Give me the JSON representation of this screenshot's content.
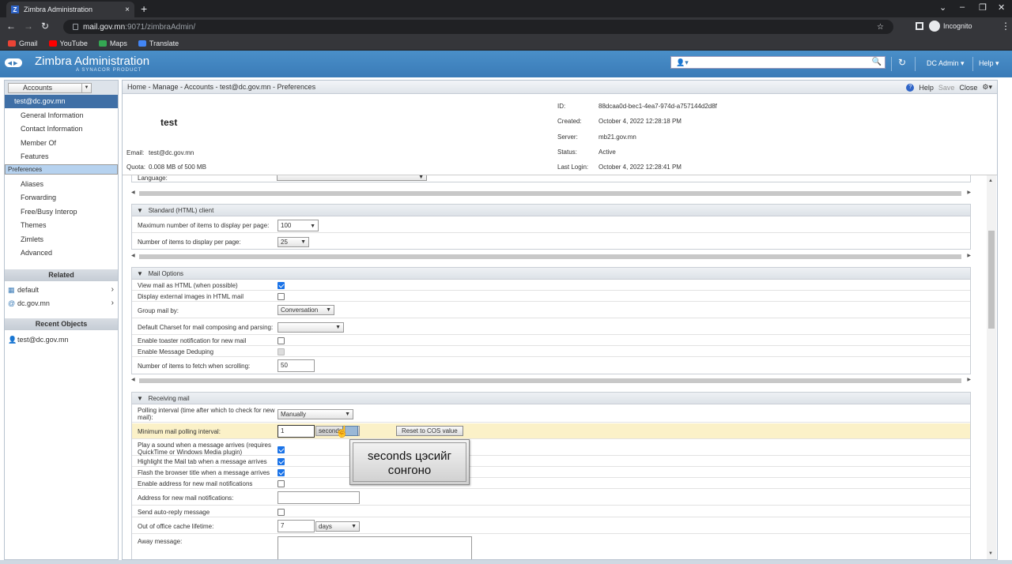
{
  "browser": {
    "tab_title": "Zimbra Administration",
    "tab_favicon": "Z",
    "url_host": "mail.gov.mn",
    "url_rest": ":9071/zimbraAdmin/",
    "incognito_label": "Incognito",
    "bookmarks": [
      {
        "label": "Gmail",
        "color": "#ea4335"
      },
      {
        "label": "YouTube",
        "color": "#ff0000"
      },
      {
        "label": "Maps",
        "color": "#34a853"
      },
      {
        "label": "Translate",
        "color": "#4285f4"
      }
    ]
  },
  "app": {
    "title": "Zimbra Administration",
    "subtitle": "A SYNACOR PRODUCT",
    "user": "DC Admin",
    "help": "Help"
  },
  "nav": {
    "selector": "Accounts",
    "header": "test@dc.gov.mn",
    "items": [
      {
        "label": "General Information"
      },
      {
        "label": "Contact Information"
      },
      {
        "label": "Member Of"
      },
      {
        "label": "Features"
      },
      {
        "label": "Preferences"
      },
      {
        "label": "Aliases"
      },
      {
        "label": "Forwarding"
      },
      {
        "label": "Free/Busy Interop"
      },
      {
        "label": "Themes"
      },
      {
        "label": "Zimlets"
      },
      {
        "label": "Advanced"
      }
    ],
    "related_title": "Related",
    "related": [
      {
        "label": "default"
      },
      {
        "label": "dc.gov.mn"
      }
    ],
    "recent_title": "Recent Objects",
    "recent": [
      {
        "label": "test@dc.gov.mn"
      }
    ]
  },
  "toolbar": {
    "breadcrumb": "Home - Manage - Accounts - test@dc.gov.mn - Preferences",
    "help": "Help",
    "save": "Save",
    "close": "Close"
  },
  "account": {
    "name": "test",
    "email_label": "Email:",
    "email": "test@dc.gov.mn",
    "quota_label": "Quota:",
    "quota": "0.008 MB of 500 MB",
    "id_label": "ID:",
    "id": "88dcaa0d-bec1-4ea7-974d-a757144d2d8f",
    "created_label": "Created:",
    "created": "October 4, 2022 12:28:18 PM",
    "server_label": "Server:",
    "server": "mb21.gov.mn",
    "status_label": "Status:",
    "status": "Active",
    "lastlogin_label": "Last Login:",
    "lastlogin": "October 4, 2022 12:28:41 PM"
  },
  "prefs": {
    "language_label": "Language:",
    "html_client": {
      "title": "Standard (HTML) client",
      "max_items_label": "Maximum number of items to display per page:",
      "max_items": "100",
      "items_label": "Number of items to display per page:",
      "items": "25"
    },
    "mail_options": {
      "title": "Mail Options",
      "view_html": "View mail as HTML (when possible)",
      "display_images": "Display external images in HTML mail",
      "group_by_label": "Group mail by:",
      "group_by": "Conversation",
      "charset_label": "Default Charset for mail composing and parsing:",
      "toaster": "Enable toaster notification for new mail",
      "dedupe": "Enable Message Deduping",
      "fetch_label": "Number of items to fetch when scrolling:",
      "fetch": "50"
    },
    "receiving": {
      "title": "Receiving mail",
      "polling_label": "Polling interval (time after which to check for new mail):",
      "polling": "Manually",
      "min_polling_label": "Minimum mail polling interval:",
      "min_polling": "1",
      "min_polling_unit": "seconds",
      "reset_button": "Reset to COS value",
      "sound_label": "Play a sound when a message arrives (requires QuickTime or Windows Media plugin)",
      "highlight_label": "Highlight the Mail tab when a message arrives",
      "flash_label": "Flash the browser title when a message arrives",
      "addr_notif_label": "Enable address for new mail notifications",
      "addr_for_label": "Address for new mail notifications:",
      "autoreply_label": "Send auto-reply message",
      "ooo_label": "Out of office cache lifetime:",
      "ooo": "7",
      "ooo_unit": "days",
      "away_label": "Away message:"
    }
  },
  "tooltip": {
    "line1": "seconds цэсийг",
    "line2": "сонгоно"
  },
  "colors": {
    "header": "#3a7bb7",
    "nav_selected": "#b6d2ef",
    "highlight_row": "#fbf1c8",
    "checkbox": "#1a73e8"
  }
}
